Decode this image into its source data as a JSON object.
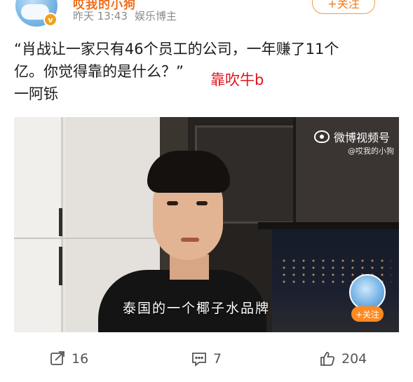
{
  "header": {
    "username": "哎我的小狗",
    "time": "昨天 13:43",
    "verification": "娱乐博主",
    "follow_label": "+关注"
  },
  "post": {
    "line1": "“肖战让一家只有46个员工的公司，一年赚了11个",
    "line2": "亿。你觉得靠的是什么？”",
    "line3": "一阿铄",
    "annotation": "靠吹牛b"
  },
  "video": {
    "watermark": "微博视频号",
    "handle": "@哎我的小狗",
    "caption": "泰国的一个椰子水品牌",
    "follow_label": "+关注"
  },
  "actions": {
    "share_count": "16",
    "comment_count": "7",
    "like_count": "204"
  },
  "colors": {
    "accent": "#f07a1a",
    "annotation": "#e0141e",
    "icon_gray": "#555555"
  }
}
